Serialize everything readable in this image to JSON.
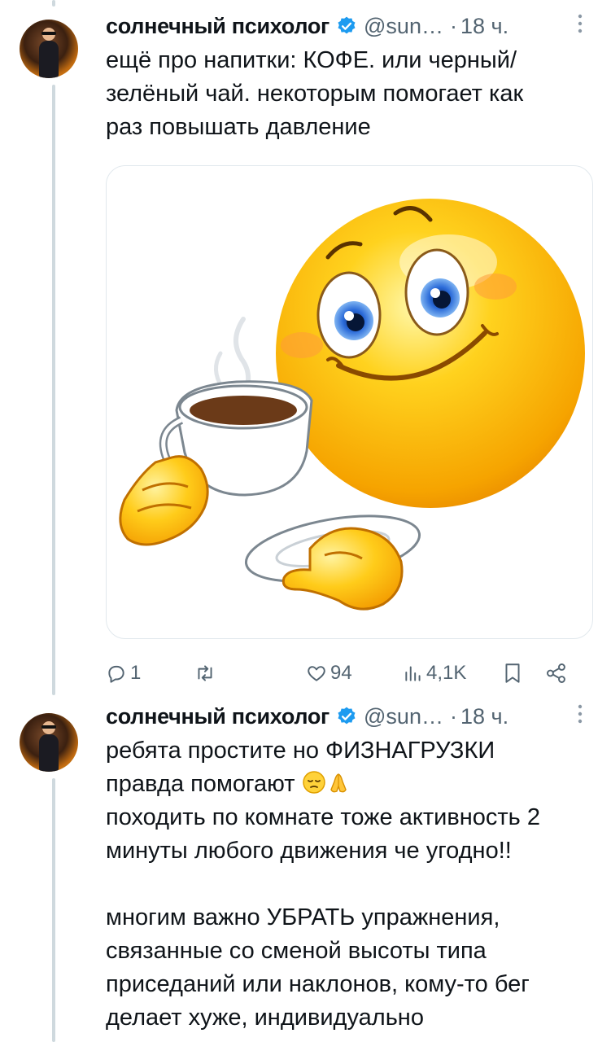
{
  "tweets": [
    {
      "author_name": "солнечный психолог",
      "handle": "@sun…",
      "dot": "·",
      "time": "18 ч.",
      "text": "ещё про напитки: КОФЕ. или черный/\nзелёный чай. некоторым помогает как\nраз повышать давление",
      "media_icon": "smiley-drinking-coffee-image",
      "actions": {
        "replies": "1",
        "retweets": "",
        "likes": "94",
        "views": "4,1K"
      }
    },
    {
      "author_name": "солнечный психолог",
      "handle": "@sun…",
      "dot": "·",
      "time": "18 ч.",
      "text_line1": "ребята простите но ФИЗНАГРУЗКИ",
      "text_line2": "правда помогают ",
      "text_rest": "походить по комнате тоже активность 2\nминуты любого движения че угодно!!\n\nмногим важно УБРАТЬ упражнения,\nсвязанные со сменой высоты типа\nприседаний или наклонов, кому-то бег\nделает хуже, индивидуально"
    }
  ],
  "colors": {
    "verified": "#1d9bf0",
    "secondary_text": "#536471",
    "thread_line": "#cfd9de"
  },
  "icons": [
    "verified-badge-icon",
    "more-icon",
    "reply-icon",
    "retweet-icon",
    "like-icon",
    "views-icon",
    "bookmark-icon",
    "share-icon",
    "pensive-face-emoji",
    "folded-hands-emoji"
  ]
}
